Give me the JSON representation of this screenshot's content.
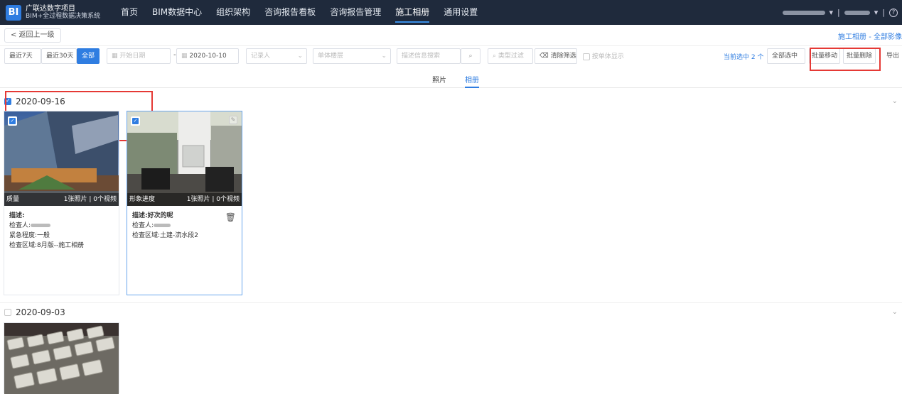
{
  "app": {
    "logo_text": "BI",
    "title_line1": "广联达数字项目",
    "title_line2": "BIM+全过程数据决策系统"
  },
  "nav": {
    "items": [
      {
        "label": "首页"
      },
      {
        "label": "BIM数据中心"
      },
      {
        "label": "组织架构"
      },
      {
        "label": "咨询报告看板"
      },
      {
        "label": "咨询报告管理"
      },
      {
        "label": "施工相册"
      },
      {
        "label": "通用设置"
      }
    ],
    "active_index": 5
  },
  "topbar": {
    "help_icon": "?"
  },
  "subbar": {
    "back_label": "< 返回上一级",
    "breadcrumb": "施工相册 - 全部影像"
  },
  "filters": {
    "range_7": "最近7天",
    "range_30": "最近30天",
    "range_all": "全部",
    "start_date_placeholder": "开始日期",
    "end_date": "2020-10-10",
    "recorder_placeholder": "记录人",
    "floor_placeholder": "单体楼层",
    "desc_search_placeholder": "描述信息搜索",
    "type_filter": "类型过滤",
    "clear_filter": "清除筛选",
    "by_unit": "按单体显示",
    "selected_info": "当前选中 2 个",
    "select_all": "全部选中",
    "batch_move": "批量移动",
    "batch_delete": "批量删除",
    "export": "导出"
  },
  "subtabs": [
    {
      "label": "照片"
    },
    {
      "label": "相册"
    }
  ],
  "groups": [
    {
      "date": "2020-09-16",
      "checked": true,
      "cards": [
        {
          "category": "质量",
          "counts": "1张照片 | 0个视频",
          "desc_label": "描述:",
          "desc_value": "",
          "inspector_label": "检查人:",
          "urgency": "紧急程度:一般",
          "area": "检查区域:8月版--施工相册",
          "selected": true
        },
        {
          "category": "形象进度",
          "counts": "1张照片 | 0个视频",
          "desc_label": "描述:",
          "desc_value": "好次的呢",
          "inspector_label": "检查人:",
          "area": "检查区域:土建-流水段2",
          "selected": true
        }
      ]
    },
    {
      "date": "2020-09-03",
      "checked": false,
      "cards": []
    }
  ]
}
